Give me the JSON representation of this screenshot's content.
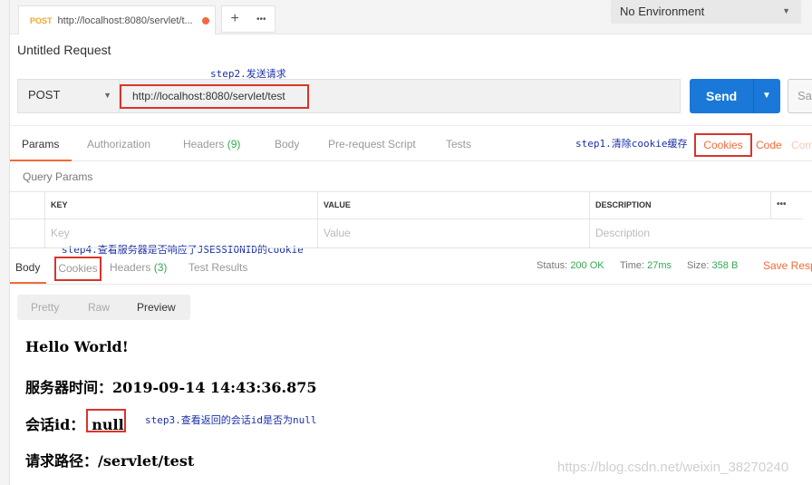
{
  "topbar": {
    "tab_method": "POST",
    "tab_url": "http://localhost:8080/servlet/t...",
    "add_tab_glyph": "+",
    "more_glyph": "•••",
    "environment": "No Environment"
  },
  "request": {
    "title": "Untitled Request",
    "method": "POST",
    "url": "http://localhost:8080/servlet/test",
    "send_label": "Send",
    "save_label": "Sa"
  },
  "request_tabs": {
    "params": "Params",
    "authorization": "Authorization",
    "headers": "Headers",
    "headers_count": "(9)",
    "body": "Body",
    "prerequest": "Pre-request Script",
    "tests": "Tests",
    "cookies": "Cookies",
    "code": "Code",
    "comments": "Com"
  },
  "params": {
    "section_title": "Query Params",
    "columns": [
      "KEY",
      "VALUE",
      "DESCRIPTION"
    ],
    "more_glyph": "•••",
    "placeholders": [
      "Key",
      "Value",
      "Description"
    ]
  },
  "response": {
    "tabs": {
      "body": "Body",
      "cookies": "Cookies",
      "headers": "Headers",
      "headers_count": "(3)",
      "test_results": "Test Results"
    },
    "status_label": "Status:",
    "status_value": "200 OK",
    "time_label": "Time:",
    "time_value": "27ms",
    "size_label": "Size:",
    "size_value": "358 B",
    "save_response": "Save Resp",
    "view_modes": [
      "Pretty",
      "Raw",
      "Preview"
    ],
    "lines": [
      "Hello World!",
      "服务器时间：2019-09-14 14:43:36.875",
      "会话id：",
      "请求路径：/servlet/test"
    ],
    "session_value": "null"
  },
  "annotations": {
    "step1": "step1.清除cookie缓存",
    "step2": "step2.发送请求",
    "step3": "step3.查看返回的会话id是否为null",
    "step4": "step4.查看服务器是否响应了JSESSIONID的cookie"
  },
  "watermark": "https://blog.csdn.net/weixin_38270240",
  "colors": {
    "accent": "#f26b3a",
    "send_button": "#1a79d8",
    "highlight_box": "#d9342b",
    "annotation_text": "#1a2fa8",
    "status_green": "#34a853"
  }
}
